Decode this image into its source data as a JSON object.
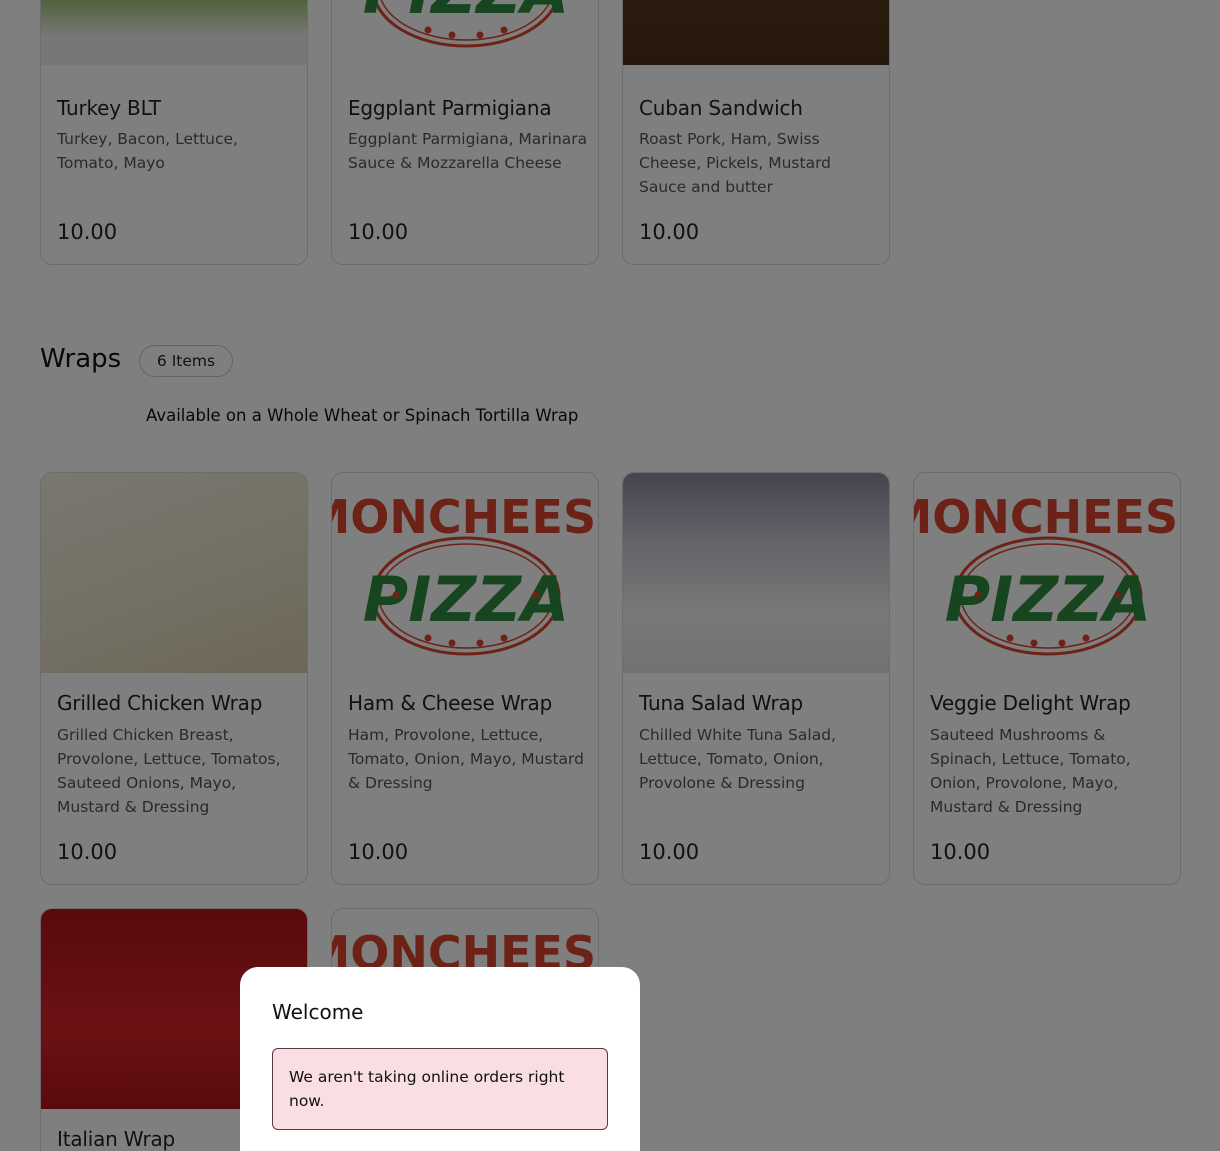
{
  "top_items": [
    {
      "name": "Turkey BLT",
      "desc": "Turkey, Bacon, Lettuce, Tomato, Mayo",
      "price": "10.00",
      "image": "photo",
      "image_desc": "turkey-blt-photo"
    },
    {
      "name": "Eggplant Parmigiana",
      "desc": "Eggplant Parmigiana, Marinara Sauce & Mozzarella Cheese",
      "price": "10.00",
      "image": "logo"
    },
    {
      "name": "Cuban Sandwich",
      "desc": "Roast Pork, Ham, Swiss Cheese, Pickels, Mustard Sauce and butter",
      "price": "10.00",
      "image": "photo",
      "image_desc": "cuban-sandwich-photo"
    }
  ],
  "wraps": {
    "title": "Wraps",
    "count": "6 Items",
    "description": "Available on a Whole Wheat or Spinach Tortilla Wrap",
    "items": [
      {
        "name": "Grilled Chicken Wrap",
        "desc": "Grilled Chicken Breast, Provolone, Lettuce, Tomatos, Sauteed Onions, Mayo, Mustard & Dressing",
        "price": "10.00",
        "image": "photo"
      },
      {
        "name": "Ham & Cheese Wrap",
        "desc": "Ham, Provolone, Lettuce, Tomato, Onion, Mayo, Mustard & Dressing",
        "price": "10.00",
        "image": "logo"
      },
      {
        "name": "Tuna Salad Wrap",
        "desc": "Chilled White Tuna Salad, Lettuce, Tomato, Onion, Provolone & Dressing",
        "price": "10.00",
        "image": "photo"
      },
      {
        "name": "Veggie Delight Wrap",
        "desc": "Sauteed Mushrooms & Spinach, Lettuce, Tomato, Onion, Provolone, Mayo, Mustard & Dressing",
        "price": "10.00",
        "image": "logo"
      },
      {
        "name": "Italian Wrap",
        "image": "photo"
      },
      {
        "image": "logo"
      }
    ]
  },
  "logo": {
    "top_text": "MONCHEESE",
    "bottom_text": "PIZZA",
    "red": "#d9442e",
    "green": "#2e8b3e"
  },
  "modal": {
    "title": "Welcome",
    "notice": "We aren't taking online orders right now."
  }
}
